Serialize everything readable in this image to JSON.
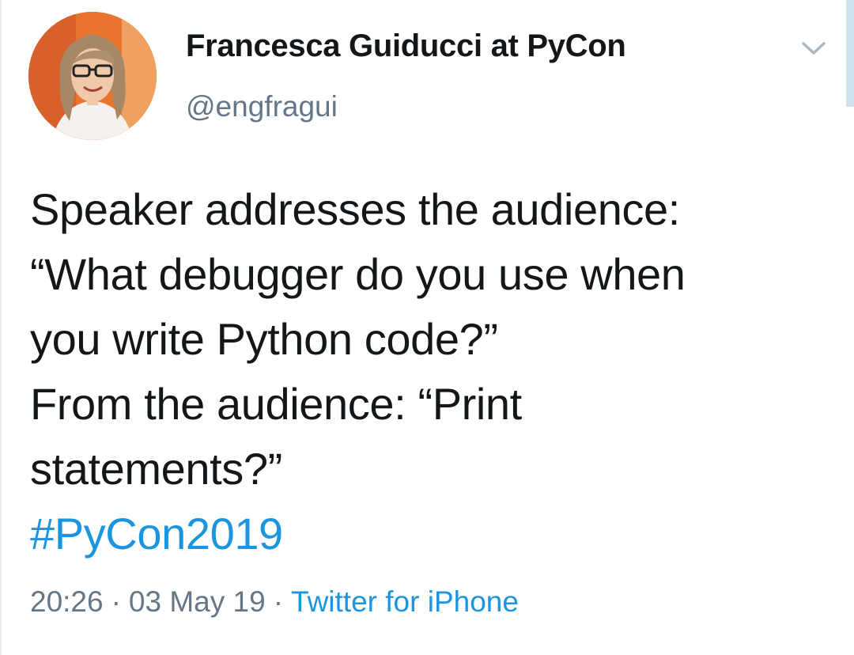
{
  "author": {
    "display_name": "Francesca Guiducci at PyCon",
    "handle": "@engfragui"
  },
  "tweet": {
    "lines": [
      "Speaker addresses the audience:",
      "“What debugger do you use when",
      "you write Python code?”",
      "From the audience: “Print",
      "statements?”"
    ],
    "hashtag": "#PyCon2019"
  },
  "meta": {
    "time": "20:26",
    "separator": "·",
    "date": "03 May 19",
    "source": "Twitter for iPhone"
  },
  "colors": {
    "link": "#1b95e0",
    "secondary_text": "#657786",
    "primary_text": "#14171a"
  },
  "icons": {
    "menu": "chevron-down-icon",
    "avatar": "profile-photo"
  }
}
